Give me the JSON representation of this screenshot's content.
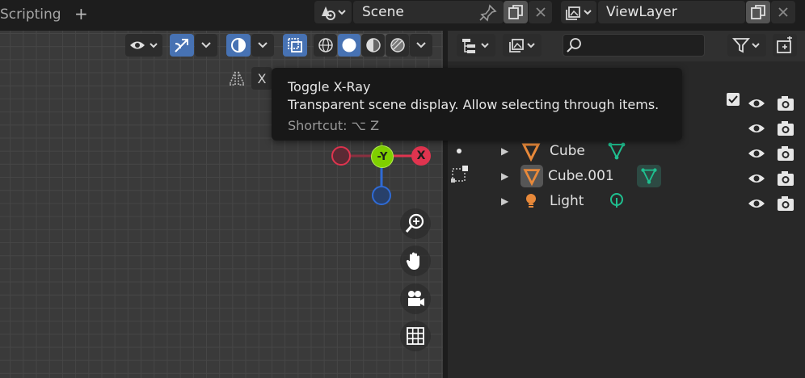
{
  "workspace_tab": {
    "label": "Scripting",
    "add": "+"
  },
  "scene": {
    "name": "Scene"
  },
  "view_layer": {
    "name": "ViewLayer"
  },
  "viewport": {
    "axis_x_label": "X",
    "gizmo": {
      "neg_y": "-Y",
      "x": "X"
    }
  },
  "tooltip": {
    "title": "Toggle X-Ray",
    "description": "Transparent scene display. Allow selecting through items.",
    "shortcut": "Shortcut: ⌥ Z"
  },
  "outliner": {
    "items": [
      {
        "label": "Cube"
      },
      {
        "label": "Cube.001"
      },
      {
        "label": "Light"
      }
    ]
  },
  "colors": {
    "accent": "#4772b3",
    "axis_x": "#e0344f",
    "axis_y": "#7fcf00",
    "axis_z": "#2f6bd6",
    "mesh_orange": "#e8893a",
    "data_green": "#1fbf8f"
  }
}
